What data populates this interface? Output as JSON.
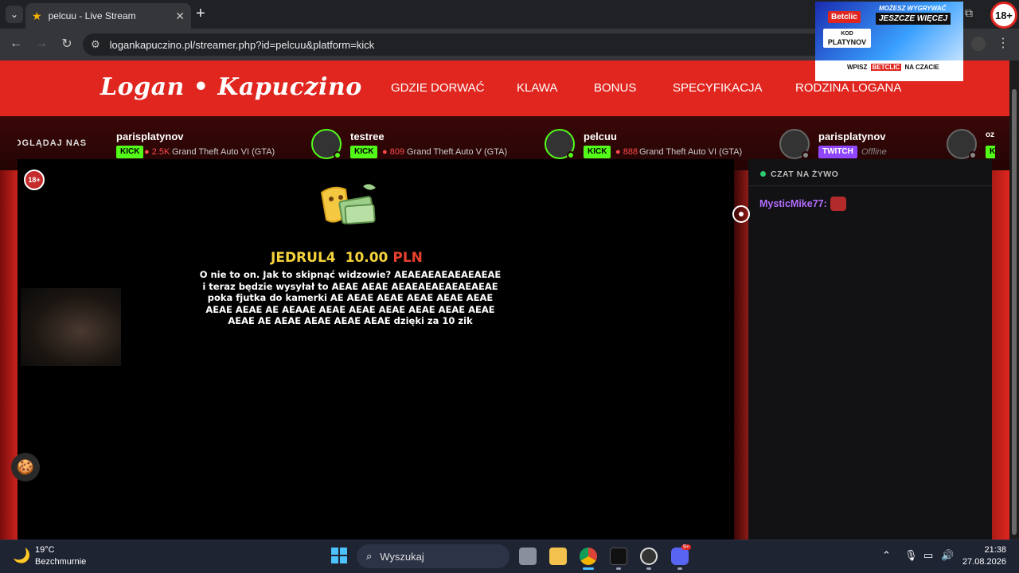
{
  "browser": {
    "tab_title": "pelcuu - Live Stream",
    "url": "logankapuczino.pl/streamer.php?id=pelcuu&platform=kick"
  },
  "site": {
    "logo": "Logan • Kapuczino",
    "nav": [
      "GDZIE DORWAĆ",
      "KLAWA",
      "BONUS",
      "SPECYFIKACJA",
      "RODZINA LOGANA"
    ]
  },
  "ticker": {
    "label": "OGLĄDAJ NAS",
    "streamers": [
      {
        "name": "parisplatynov",
        "platform": "KICK",
        "viewers": "2.5K",
        "game": "Grand Theft Auto VI (GTA)"
      },
      {
        "name": "testree",
        "platform": "KICK",
        "viewers": "809",
        "game": "Grand Theft Auto V (GTA)"
      },
      {
        "name": "pelcuu",
        "platform": "KICK",
        "viewers": "888",
        "game": "Grand Theft Auto VI (GTA)"
      },
      {
        "name": "parisplatynov",
        "platform": "TWITCH",
        "status": "Offline"
      },
      {
        "name": "oz",
        "platform": "KICK"
      }
    ]
  },
  "video": {
    "age_badge": "18+",
    "alert": {
      "name": "JEDRUL4",
      "amount": "10.00",
      "currency": "PLN",
      "message": "O nie to on. Jak to skipnąć widzowie? AEAEAEAEAEAEAEAE i teraz będzie wysyłał to AEAE AEAE AEAEAEAEAEAEAEAE poka fjutka do kamerki AE AEAE AEAE AEAE AEAE AEAE AEAE AEAE AE AEAAE AEAE AEAE AEAE AEAE AEAE AEAE AEAE AE AEAE AEAE AEAE AEAE dzięki za 10 zik"
    }
  },
  "chat": {
    "title": "CZAT NA ŻYWO",
    "messages": [
      {
        "user": "MysticMike77:"
      }
    ]
  },
  "ad": {
    "top": "MOŻESZ WYGRYWAĆ",
    "big": "JESZCZE WIĘCEJ",
    "brand": "Betclic",
    "kod_label": "KOD",
    "kod_value": "PLATYNOV",
    "bottom_prefix": "WPISZ",
    "bottom_brand": "BETCLIC",
    "bottom_suffix": "NA CZACIE",
    "age": "18+"
  },
  "taskbar": {
    "temp": "19°C",
    "weather": "Bezchmurnie",
    "search": "Wyszukaj",
    "time": "21:38",
    "date": "27.08.2026",
    "discord_badge": "9+"
  }
}
